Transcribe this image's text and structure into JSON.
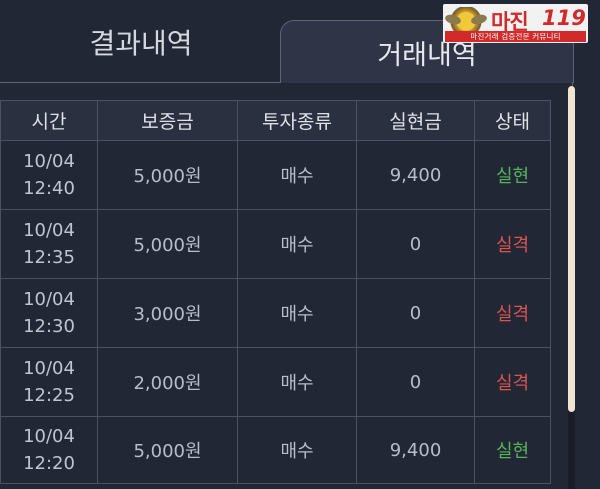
{
  "tabs": [
    {
      "label": "결과내역",
      "active": false
    },
    {
      "label": "거래내역",
      "active": true
    }
  ],
  "watermark": {
    "brand": "마진",
    "number": "119",
    "tagline": "마진거래 검증전문 커뮤니티"
  },
  "table": {
    "headers": [
      "시간",
      "보증금",
      "투자종류",
      "실현금",
      "상태"
    ],
    "rows": [
      {
        "date": "10/04",
        "time": "12:40",
        "deposit": "5,000원",
        "type": "매수",
        "realized": "9,400",
        "status": "실현",
        "status_kind": "ok"
      },
      {
        "date": "10/04",
        "time": "12:35",
        "deposit": "5,000원",
        "type": "매수",
        "realized": "0",
        "status": "실격",
        "status_kind": "fail"
      },
      {
        "date": "10/04",
        "time": "12:30",
        "deposit": "3,000원",
        "type": "매수",
        "realized": "0",
        "status": "실격",
        "status_kind": "fail"
      },
      {
        "date": "10/04",
        "time": "12:25",
        "deposit": "2,000원",
        "type": "매수",
        "realized": "0",
        "status": "실격",
        "status_kind": "fail"
      },
      {
        "date": "10/04",
        "time": "12:20",
        "deposit": "5,000원",
        "type": "매수",
        "realized": "9,400",
        "status": "실현",
        "status_kind": "ok"
      }
    ]
  },
  "colors": {
    "background": "#222736",
    "status_ok": "#54b45a",
    "status_fail": "#d9534f"
  }
}
